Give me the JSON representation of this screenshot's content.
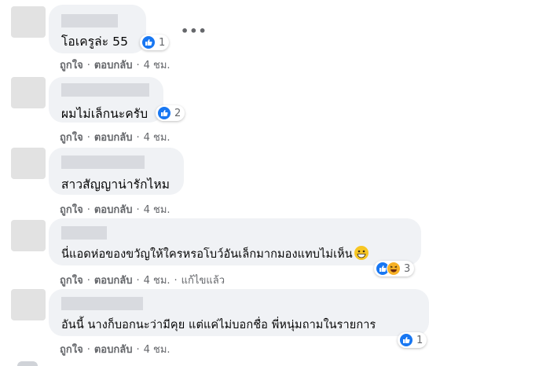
{
  "comments": [
    {
      "text": "โอเครูล่ะ 55",
      "reactions": "1",
      "meta": {
        "like": "ถูกใจ",
        "reply": "ตอบกลับ",
        "time": "4 ชม."
      }
    },
    {
      "text": "ผมไม่เล็กนะครับ",
      "reactions": "2",
      "meta": {
        "like": "ถูกใจ",
        "reply": "ตอบกลับ",
        "time": "4 ชม."
      }
    },
    {
      "text": "สาวสัญญาน่ารักไหม",
      "meta": {
        "like": "ถูกใจ",
        "reply": "ตอบกลับ",
        "time": "4 ชม."
      }
    },
    {
      "text": "นี่แอดห่อของขวัญให้ใครหรอโบว์อันเล็กมากมองแทบไม่เห็น",
      "reactions": "3",
      "meta": {
        "like": "ถูกใจ",
        "reply": "ตอบกลับ",
        "time": "4 ชม.",
        "edited": "แก้ไขแล้ว"
      }
    },
    {
      "text": "อันนี้ นางก็บอกนะว่ามีคุย แต่แค่ไม่บอกชื่อ พี่หนุ่มถามในรายการ",
      "reactions": "1",
      "meta": {
        "like": "ถูกใจ",
        "reply": "ตอบกลับ",
        "time": "4 ชม."
      }
    }
  ],
  "menu": {
    "more": "•••"
  },
  "colors": {
    "accent": "#1877f2",
    "bubble": "#f0f2f5",
    "meta": "#65676b"
  },
  "icons": {
    "reaction_like": "like-icon",
    "reaction_haha": "haha-icon",
    "inline_emoji": "grinning-emoji-icon"
  }
}
